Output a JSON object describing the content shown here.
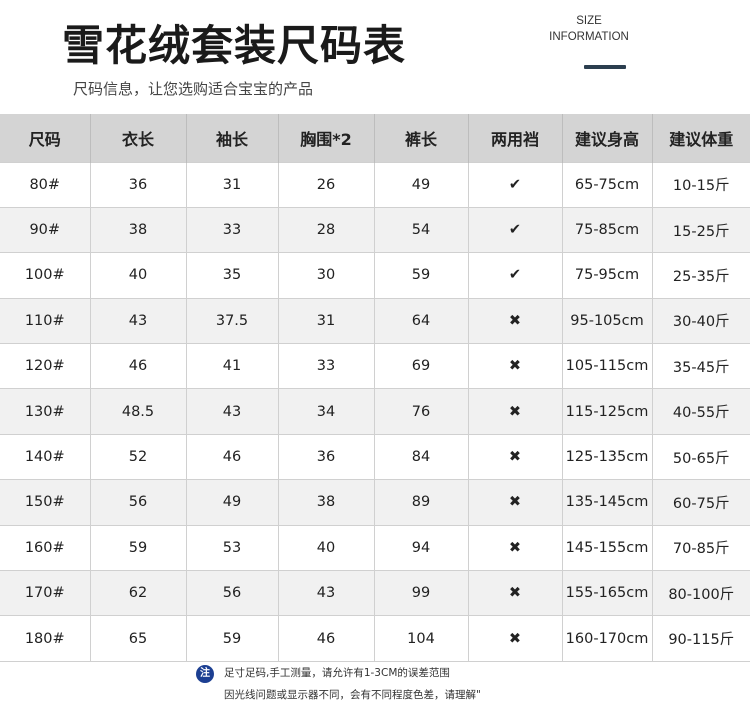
{
  "header": {
    "title": "雪花绒套装尺码表",
    "size_label_line1": "SIZE",
    "size_label_line2": "INFORMATION",
    "subtitle": "尺码信息，让您选购适合宝宝的产品"
  },
  "table": {
    "columns": [
      "尺码",
      "衣长",
      "袖长",
      "胸围*2",
      "裤长",
      "两用裆",
      "建议身高",
      "建议体重"
    ],
    "rows": [
      [
        "80#",
        "36",
        "31",
        "26",
        "49",
        "✔",
        "65-75cm",
        "10-15斤"
      ],
      [
        "90#",
        "38",
        "33",
        "28",
        "54",
        "✔",
        "75-85cm",
        "15-25斤"
      ],
      [
        "100#",
        "40",
        "35",
        "30",
        "59",
        "✔",
        "75-95cm",
        "25-35斤"
      ],
      [
        "110#",
        "43",
        "37.5",
        "31",
        "64",
        "✖",
        "95-105cm",
        "30-40斤"
      ],
      [
        "120#",
        "46",
        "41",
        "33",
        "69",
        "✖",
        "105-115cm",
        "35-45斤"
      ],
      [
        "130#",
        "48.5",
        "43",
        "34",
        "76",
        "✖",
        "115-125cm",
        "40-55斤"
      ],
      [
        "140#",
        "52",
        "46",
        "36",
        "84",
        "✖",
        "125-135cm",
        "50-65斤"
      ],
      [
        "150#",
        "56",
        "49",
        "38",
        "89",
        "✖",
        "135-145cm",
        "60-75斤"
      ],
      [
        "160#",
        "59",
        "53",
        "40",
        "94",
        "✖",
        "145-155cm",
        "70-85斤"
      ],
      [
        "170#",
        "62",
        "56",
        "43",
        "99",
        "✖",
        "155-165cm",
        "80-100斤"
      ],
      [
        "180#",
        "65",
        "59",
        "46",
        "104",
        "✖",
        "160-170cm",
        "90-115斤"
      ]
    ]
  },
  "note": {
    "badge": "注",
    "line1": "足寸足码,手工测量，请允许有1-3CM的误差范围",
    "line2": "因光线问题或显示器不同，会有不同程度色差，请理解\""
  },
  "colors": {
    "header_bg": "#d4d4d4",
    "stripe_bg": "#f1f1f1",
    "accent_bar": "#2b3e4f",
    "note_badge": "#1c3f92"
  }
}
